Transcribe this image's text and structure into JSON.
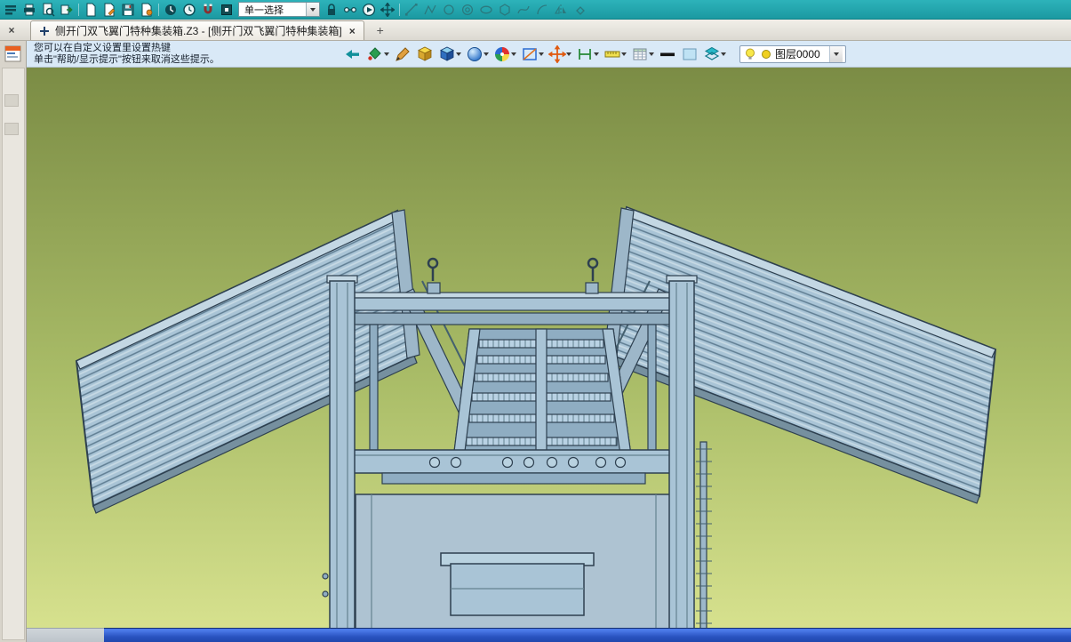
{
  "window": {
    "tab": {
      "label": "侧开门双飞翼门特种集装箱.Z3 - [侧开门双飞翼门特种集装箱]",
      "close_label": "×"
    },
    "new_tab_label": "+",
    "sidebar_close_label": "×"
  },
  "top_toolbar": {
    "selection_mode": {
      "value": "单一选择"
    },
    "icon_names": [
      "app-menu",
      "printer",
      "print-preview",
      "export",
      "new-document",
      "edit-document",
      "save",
      "document-settings",
      "history",
      "clock",
      "magnet",
      "record-box",
      "lock",
      "link-nodes",
      "play-circle",
      "pan-arrows",
      "line-tool",
      "polyline-tool",
      "circle-tool",
      "concentric-circles",
      "ellipse-tool",
      "polygon-tool",
      "spline-tool",
      "arc-tool",
      "mirror-tool",
      "eraser-tool"
    ]
  },
  "ribbon": {
    "hints": {
      "line1": "您可以在自定义设置里设置热键",
      "line2": "单击\"帮助/显示提示\"按钮来取消这些提示。"
    },
    "layer_selector": {
      "value": "图层0000"
    },
    "icon_names": [
      "back",
      "repaint",
      "brush",
      "cube-yellow",
      "cube-blue",
      "shaded-sphere",
      "color-wheel",
      "section-frame",
      "move-target",
      "dimension",
      "ruler",
      "grid-table",
      "thick-line",
      "swatch",
      "layers",
      "lightbulb"
    ]
  },
  "viewport": {
    "background_top": "#7b8c45",
    "background_bottom": "#d9e390",
    "model_fill": "#a9c4d6",
    "model_outline": "#2e4050"
  },
  "taskbar": {
    "color": "#2a53c0"
  }
}
